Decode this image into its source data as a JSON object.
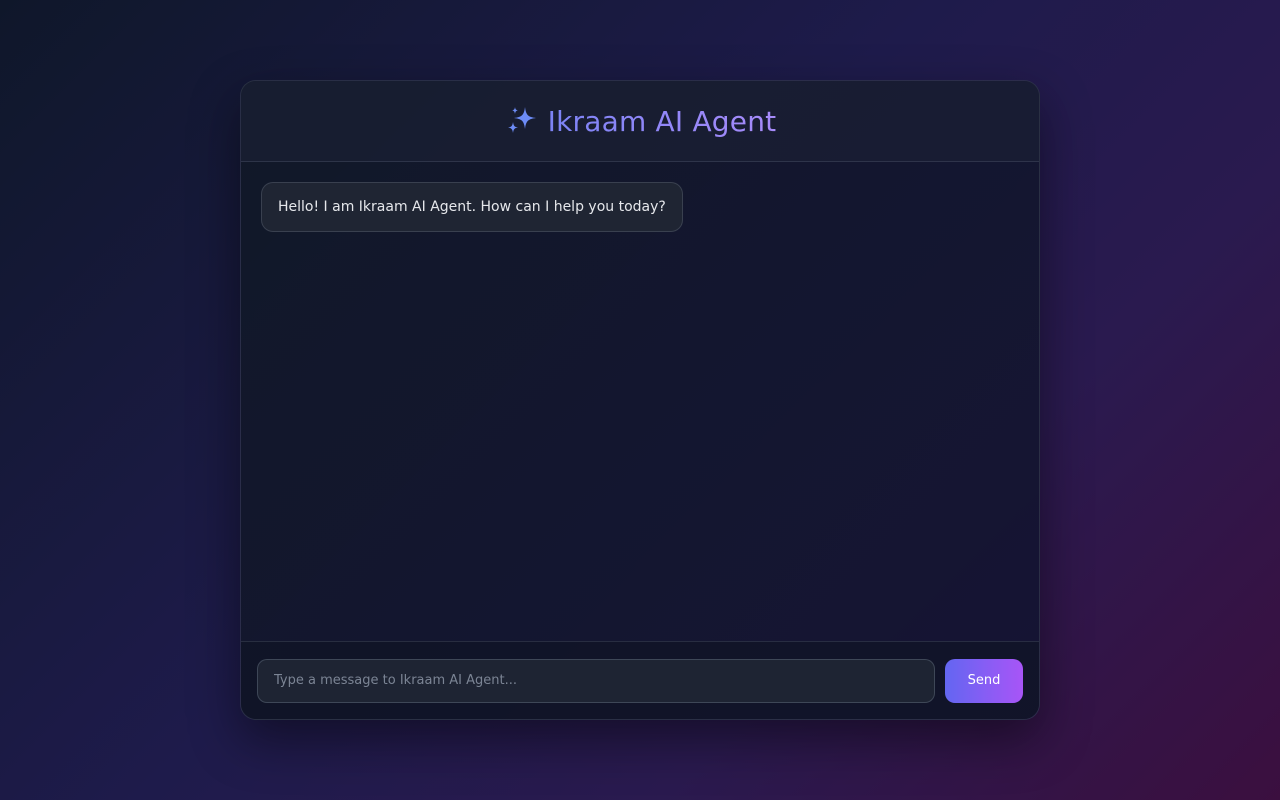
{
  "header": {
    "icon": "sparkles-icon",
    "title": "Ikraam AI Agent"
  },
  "messages": [
    {
      "role": "agent",
      "text": "Hello! I am Ikraam AI Agent. How can I help you today?"
    }
  ],
  "composer": {
    "placeholder": "Type a message to Ikraam AI Agent...",
    "value": "",
    "send_label": "Send"
  },
  "colors": {
    "accent_start": "#6366f1",
    "accent_end": "#a855f7",
    "title": "#8b8ff8",
    "sparkle": "#6d8cf7"
  }
}
